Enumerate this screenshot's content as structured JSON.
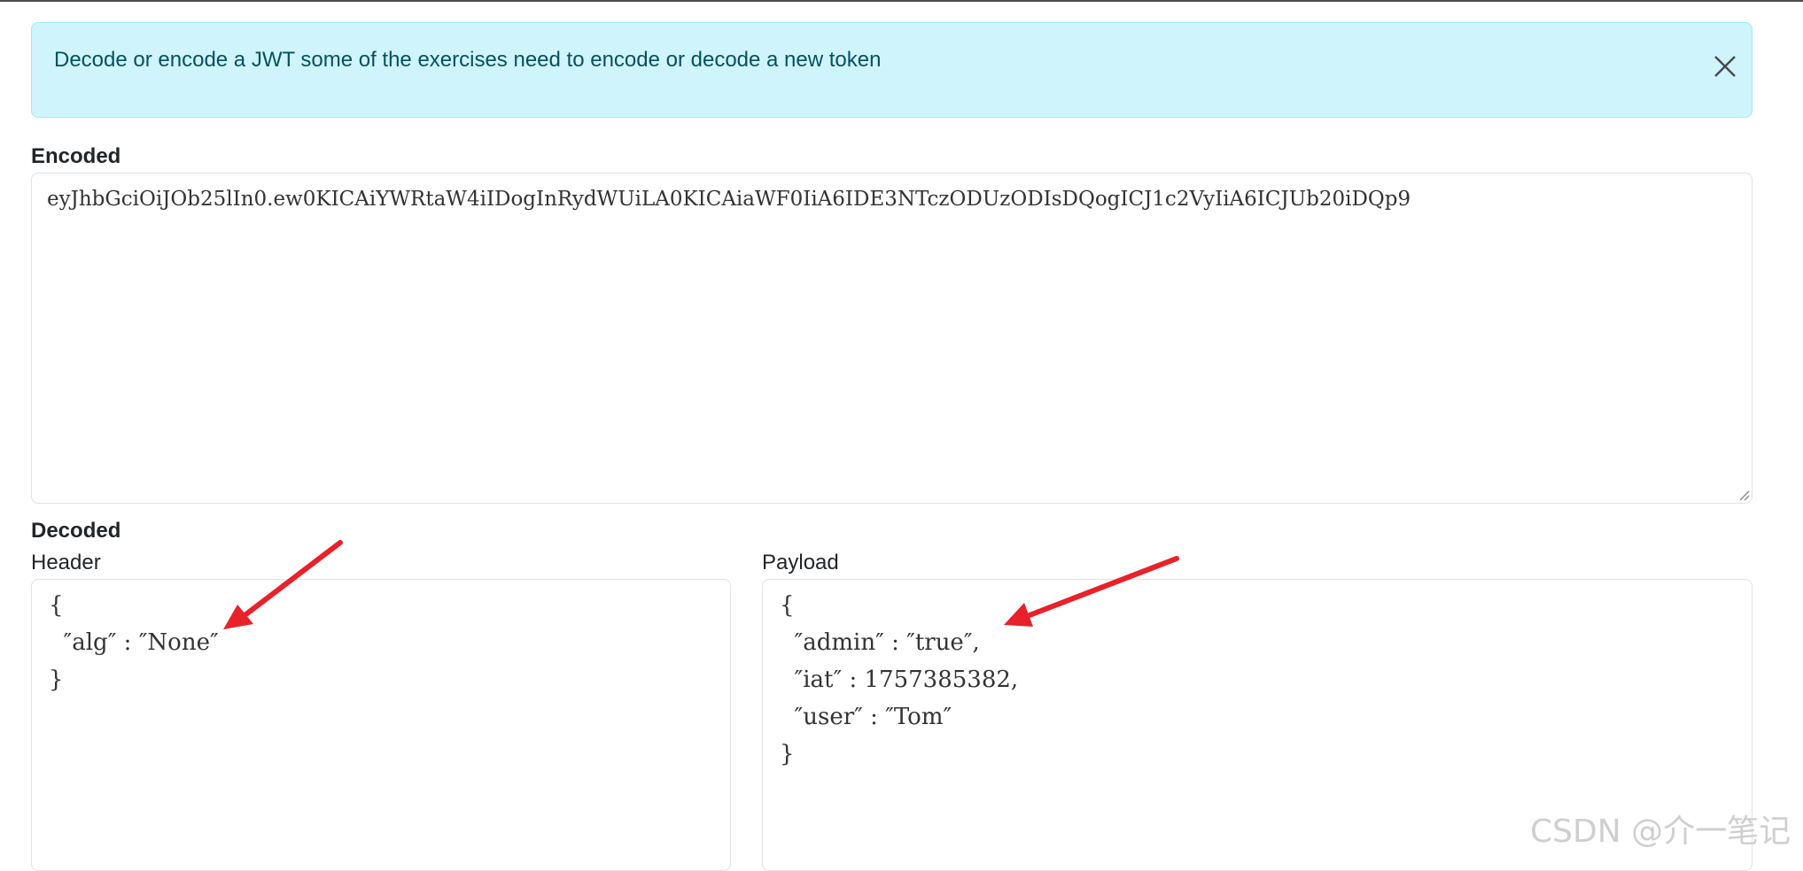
{
  "alert": {
    "message": "Decode or encode a JWT some of the exercises need to encode or decode a new token",
    "close_icon": "close-icon"
  },
  "encoded": {
    "label": "Encoded",
    "value": "eyJhbGciOiJOb25lIn0.ew0KICAiYWRtaW4iIDogInRydWUiLA0KICAiaWF0IiA6IDE3NTczODUzODIsDQogICJ1c2VyIiA6ICJUb20iDQp9"
  },
  "decoded": {
    "label": "Decoded",
    "header": {
      "label": "Header",
      "lines": [
        "{",
        "  ″alg″ : ″None″",
        "}"
      ]
    },
    "payload": {
      "label": "Payload",
      "lines": [
        "{",
        "  ″admin″ : ″true″,",
        "  ″iat″ : 1757385382,",
        "  ″user″ : ″Tom″",
        "}"
      ]
    }
  },
  "colors": {
    "alert_bg": "#cff4fc",
    "alert_text": "#055160",
    "annotation_arrow": "#e8212a"
  },
  "watermark": "CSDN @介一笔记"
}
